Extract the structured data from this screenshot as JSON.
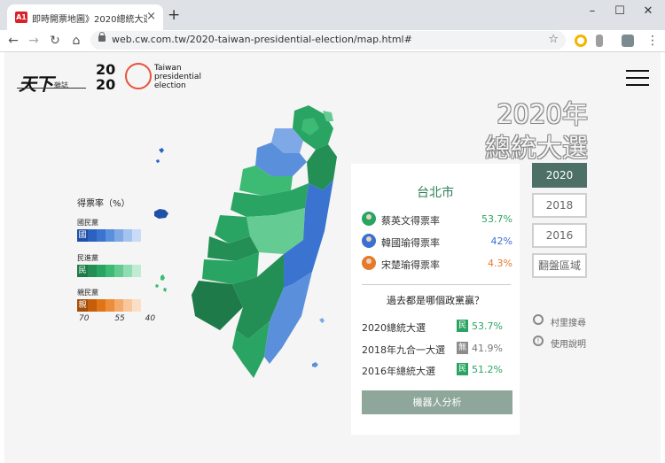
{
  "browser": {
    "tab_title": "即時開票地圖》2020總統大選",
    "favicon_text": "A1",
    "url": "web.cw.com.tw/2020-taiwan-presidential-election/map.html#"
  },
  "header": {
    "brand": "天下",
    "brand_sub": "雜誌",
    "logo_top": "20",
    "logo_bottom": "20",
    "logo_lines": [
      "Taiwan",
      "presidential",
      "election"
    ]
  },
  "title": {
    "line1": "2020年",
    "line2": "總統大選"
  },
  "legend": {
    "title": "得票率（%）",
    "parties": [
      {
        "name": "國民黨",
        "badge": "國",
        "colors": [
          "#1f4fa6",
          "#2c62bf",
          "#3b74d0",
          "#5a8fdc",
          "#7ea9e6",
          "#a5c3ef",
          "#c9dcf7"
        ]
      },
      {
        "name": "民進黨",
        "badge": "民",
        "colors": [
          "#1e7a48",
          "#238f55",
          "#2aa462",
          "#3dbb74",
          "#64cc92",
          "#92dcb2",
          "#c0ecd2"
        ]
      },
      {
        "name": "親民黨",
        "badge": "親",
        "colors": [
          "#a34d07",
          "#c55d0b",
          "#e07417",
          "#ec8d3c",
          "#f3aa6b",
          "#f8c79d",
          "#fbdfc5"
        ]
      }
    ],
    "ticks": [
      "70",
      "55",
      "40"
    ]
  },
  "card": {
    "city": "台北市",
    "candidates": [
      {
        "name": "蔡英文得票率",
        "pct": "53.7%",
        "color": "#2aa462",
        "avatar_color": "#2aa462"
      },
      {
        "name": "韓國瑜得票率",
        "pct": "42%",
        "color": "#3b6fd0",
        "avatar_color": "#3b6fd0"
      },
      {
        "name": "宋楚瑜得票率",
        "pct": "4.3%",
        "color": "#e67a2a",
        "avatar_color": "#e67a2a"
      }
    ],
    "history_title": "過去都是哪個政黨贏？",
    "history": [
      {
        "label": "2020總統大選",
        "badge": "民",
        "badge_color": "#2aa462",
        "pct": "53.7%",
        "pct_color": "#2aa462"
      },
      {
        "label": "2018年九合一大選",
        "badge": "無",
        "badge_color": "#8c8c8c",
        "pct": "41.9%",
        "pct_color": "#777777"
      },
      {
        "label": "2016年總統大選",
        "badge": "民",
        "badge_color": "#2aa462",
        "pct": "51.2%",
        "pct_color": "#2aa462"
      }
    ],
    "robot_button": "機器人分析"
  },
  "years": [
    "2020",
    "2018",
    "2016",
    "翻盤區域"
  ],
  "side_links": {
    "search": "村里搜尋",
    "help": "使用說明"
  }
}
